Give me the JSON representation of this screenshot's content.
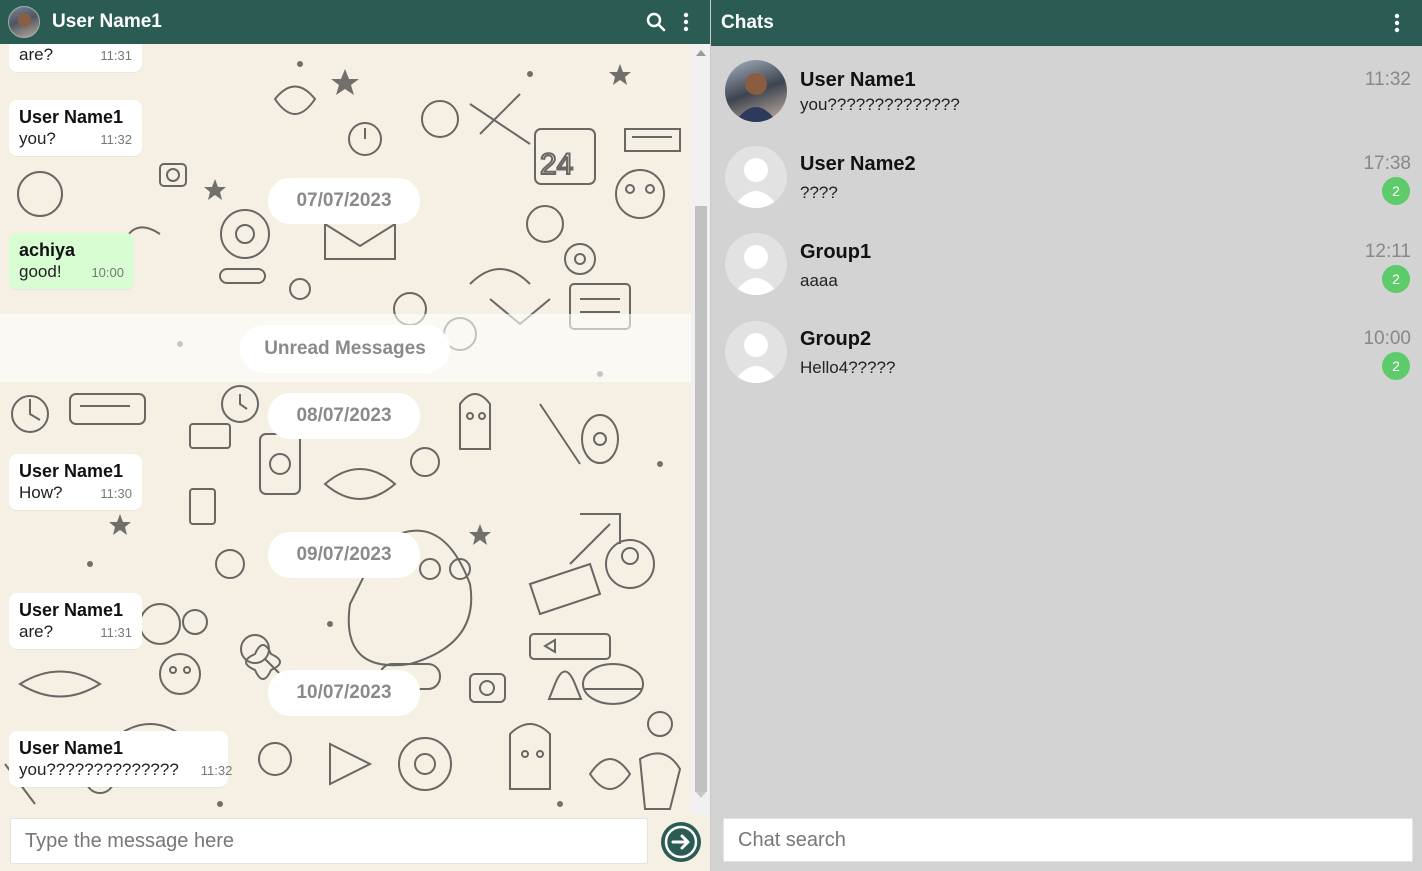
{
  "colors": {
    "header": "#2b5c54",
    "outgoing_bubble": "#d9fdd3",
    "badge": "#5ecb6a",
    "wallpaper": "#f5efe4",
    "list_bg": "#d3d3d3"
  },
  "chat": {
    "title": "User Name1",
    "icons": {
      "avatar": "user-photo",
      "search": "search-icon",
      "menu": "kebab-menu-icon",
      "send": "arrow-right-icon"
    },
    "messages": [
      {
        "sender": "",
        "text": "are?",
        "time": "11:31"
      },
      {
        "sender": "User Name1",
        "text": "you?",
        "time": "11:32"
      },
      {
        "sender": "achiya",
        "text": "good!",
        "time": "10:00"
      },
      {
        "sender": "User Name1",
        "text": "How?",
        "time": "11:30"
      },
      {
        "sender": "User Name1",
        "text": "are?",
        "time": "11:31"
      },
      {
        "sender": "User Name1",
        "text": "you??????????????",
        "time": "11:32"
      }
    ],
    "dates": [
      "07/07/2023",
      "08/07/2023",
      "09/07/2023",
      "10/07/2023"
    ],
    "unread_label": "Unread Messages",
    "input_placeholder": "Type the message here"
  },
  "list": {
    "title": "Chats",
    "items": [
      {
        "name": "User Name1",
        "preview": "you??????????????",
        "time": "11:32",
        "badge": ""
      },
      {
        "name": "User Name2",
        "preview": "????",
        "time": "17:38",
        "badge": "2"
      },
      {
        "name": "Group1",
        "preview": "aaaa",
        "time": "12:11",
        "badge": "2"
      },
      {
        "name": "Group2",
        "preview": "Hello4?????",
        "time": "10:00",
        "badge": "2"
      }
    ],
    "search_placeholder": "Chat search"
  }
}
